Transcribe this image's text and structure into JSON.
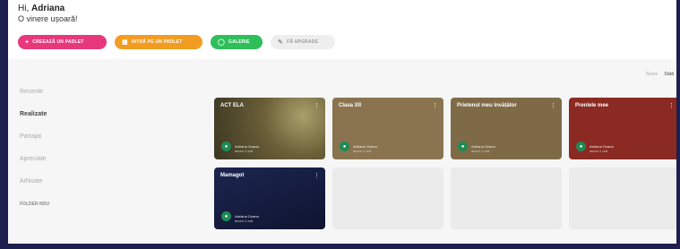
{
  "header": {
    "greeting": "Hi,",
    "user_name": "Adriana",
    "subtitle": "O vinere ușoară!"
  },
  "actions": [
    {
      "label": "Creează un padlet",
      "icon": "plus-icon"
    },
    {
      "label": "Intră pe un padlet",
      "icon": "keypad-icon"
    },
    {
      "label": "Galerie",
      "icon": "gallery-icon"
    },
    {
      "label": "Fă upgrade",
      "icon": "brush-icon"
    }
  ],
  "sorter": {
    "options": [
      "Nume",
      "Dată"
    ],
    "selected": "Dată"
  },
  "sidebar": {
    "items": [
      {
        "label": "Recente"
      },
      {
        "label": "Realizate",
        "active": true
      },
      {
        "label": "Partajat"
      },
      {
        "label": "Apreciate"
      },
      {
        "label": "Arhivate"
      },
      {
        "label": "FOLDER NOU"
      }
    ]
  },
  "padlets": [
    {
      "title": "ACT ELA",
      "author": "Adriana Ozana",
      "time": "acum 1 oră",
      "bg": "#6b5f38"
    },
    {
      "title": "Clasa XII",
      "author": "Adriana Ozana",
      "time": "acum 1 oră",
      "bg": "#8a7450"
    },
    {
      "title": "Prietenul meu învățător",
      "author": "Adriana Ozana",
      "time": "acum 1 oră",
      "bg": "#7e6a47"
    },
    {
      "title": "Prenlele mee",
      "author": "Adriana Ozana",
      "time": "acum 1 oră",
      "bg": "#8a2a22"
    },
    {
      "title": "Mamagot",
      "author": "Adriana Ozana",
      "time": "acum 1 oră",
      "bg": "#141b3d"
    }
  ]
}
